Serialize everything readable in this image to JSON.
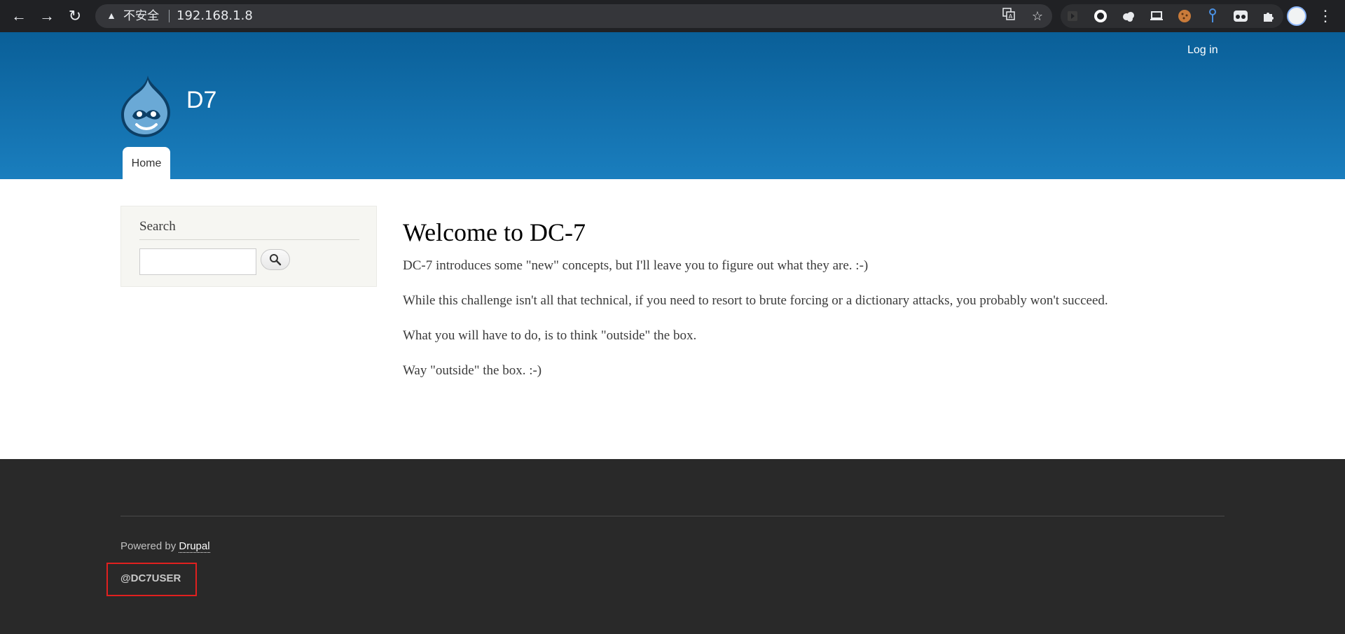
{
  "browser": {
    "security_label": "不安全",
    "url": "192.168.1.8",
    "colors": {
      "frame": "#202124",
      "omnibox": "#35363a"
    }
  },
  "header": {
    "login_label": "Log in",
    "site_name": "D7",
    "nav_tabs": [
      {
        "label": "Home",
        "active": true
      }
    ],
    "colors": {
      "gradient_top": "#0a5f98",
      "gradient_bottom": "#1a7ebe"
    }
  },
  "sidebar": {
    "search_title": "Search",
    "search_input_value": "",
    "search_button_icon": "magnifier-icon"
  },
  "main": {
    "title": "Welcome to DC-7",
    "paragraphs": [
      "DC-7 introduces some \"new\" concepts, but I'll leave you to figure out what they are.  :-)",
      "While this challenge isn't all that technical, if you need to resort to brute forcing or a dictionary attacks, you probably won't succeed.",
      "What you will have to do, is to think \"outside\" the box.",
      "Way \"outside\" the box.  :-)"
    ]
  },
  "footer": {
    "powered_prefix": "Powered by",
    "powered_link": "Drupal",
    "user_handle": "@DC7USER",
    "highlight_color": "#e0201f"
  }
}
